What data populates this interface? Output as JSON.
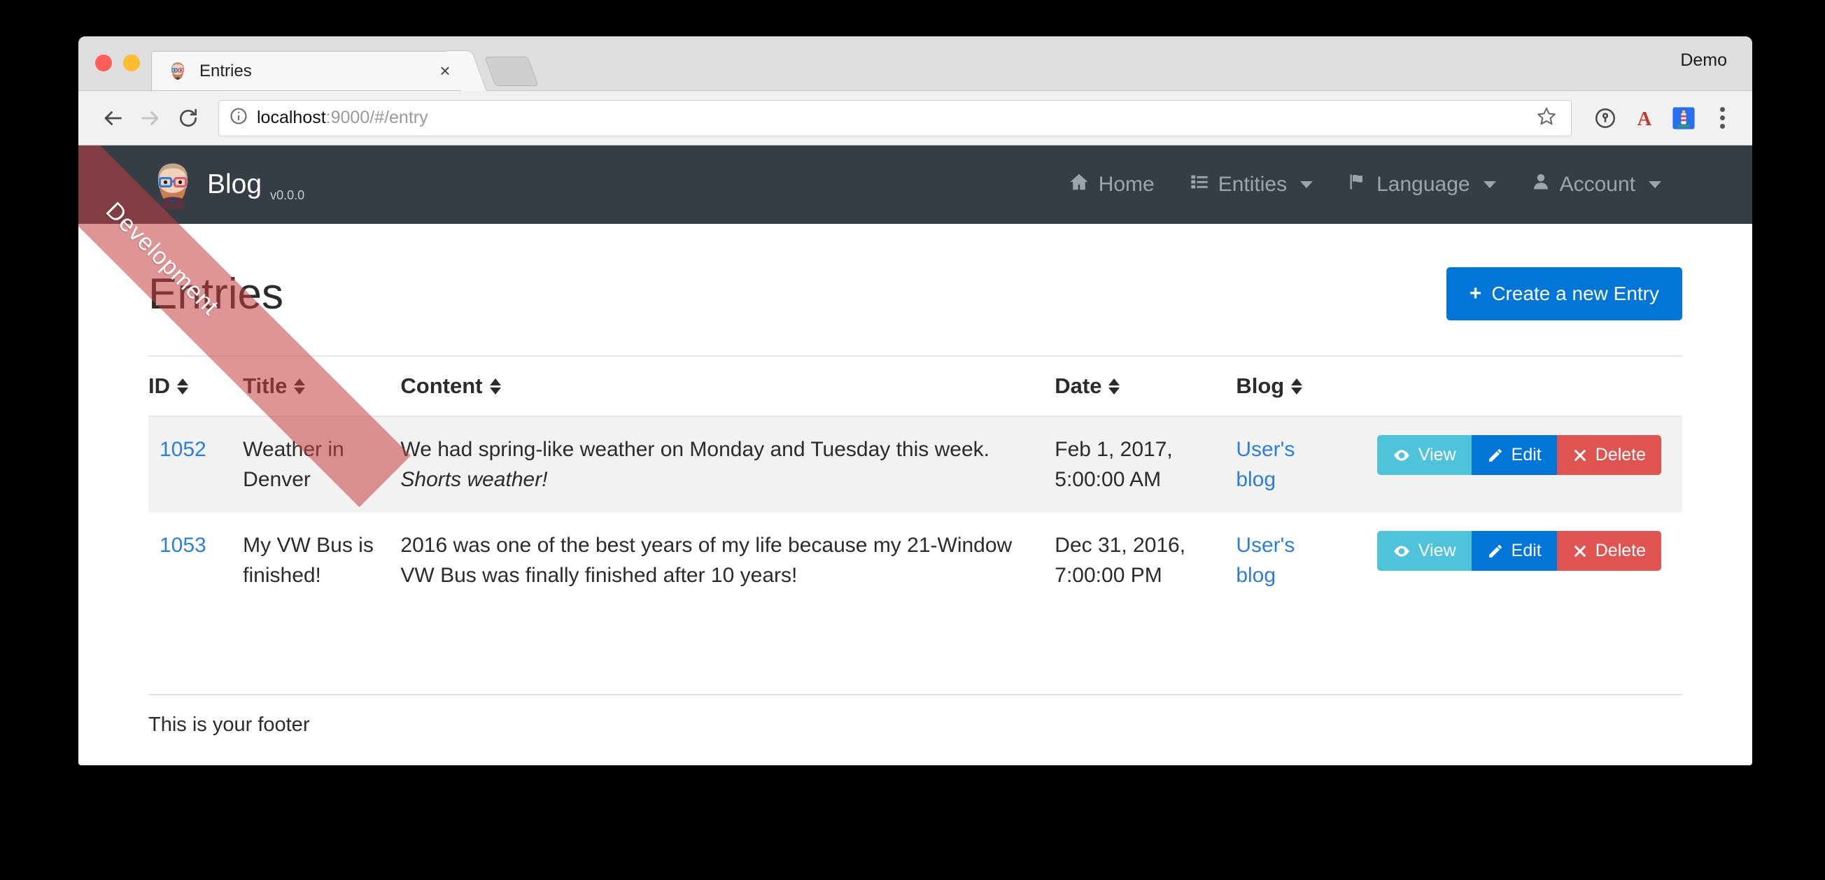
{
  "browser": {
    "profile_label": "Demo",
    "tab": {
      "title": "Entries",
      "favicon": "bearded-face-favicon",
      "close_label": "×"
    },
    "new_tab_label": "",
    "url": {
      "host": "localhost",
      "rest": ":9000/#/entry",
      "full": "localhost:9000/#/entry"
    },
    "toolbar_icons": [
      "back-arrow-icon",
      "forward-arrow-icon",
      "reload-icon",
      "info-circle-icon",
      "bookmark-star-icon",
      "onepassword-icon",
      "adblock-a-icon",
      "lighthouse-icon",
      "browser-menu-icon"
    ]
  },
  "ribbon": {
    "label": "Development",
    "color": "#c43e3e"
  },
  "navbar": {
    "brand": {
      "title": "Blog",
      "version": "v0.0.0",
      "logo": "jhipster-avatar-icon"
    },
    "items": [
      {
        "label": "Home",
        "icon": "home-icon",
        "caret": false
      },
      {
        "label": "Entities",
        "icon": "list-icon",
        "caret": true
      },
      {
        "label": "Language",
        "icon": "flag-icon",
        "caret": true
      },
      {
        "label": "Account",
        "icon": "user-icon",
        "caret": true
      }
    ],
    "background": "#353d47"
  },
  "page": {
    "title": "Entries",
    "create_button": {
      "label": "Create a new Entry",
      "icon": "plus-icon",
      "color": "#0275d8"
    }
  },
  "table": {
    "columns": [
      {
        "key": "id",
        "label": "ID",
        "sortable": true
      },
      {
        "key": "title",
        "label": "Title",
        "sortable": true
      },
      {
        "key": "content",
        "label": "Content",
        "sortable": true
      },
      {
        "key": "date",
        "label": "Date",
        "sortable": true
      },
      {
        "key": "blog",
        "label": "Blog",
        "sortable": true
      },
      {
        "key": "actions",
        "label": "",
        "sortable": false
      }
    ],
    "rows": [
      {
        "id": "1052",
        "title": "Weather in Denver",
        "content_main": "We had spring-like weather on Monday and Tuesday this week.",
        "content_em": "Shorts weather!",
        "date": "Feb 1, 2017, 5:00:00 AM",
        "blog": "User's blog"
      },
      {
        "id": "1053",
        "title": "My VW Bus is finished!",
        "content_main": "2016 was one of the best years of my life because my 21-Window VW Bus was finally finished after 10 years!",
        "content_em": "",
        "date": "Dec 31, 2016, 7:00:00 PM",
        "blog": "User's blog"
      }
    ],
    "actions": [
      {
        "key": "view",
        "label": "View",
        "icon": "eye-icon",
        "color": "#4ec3da"
      },
      {
        "key": "edit",
        "label": "Edit",
        "icon": "pencil-icon",
        "color": "#0275d8"
      },
      {
        "key": "delete",
        "label": "Delete",
        "icon": "close-x-icon",
        "color": "#df5451"
      }
    ]
  },
  "footer": {
    "text": "This is your footer"
  }
}
